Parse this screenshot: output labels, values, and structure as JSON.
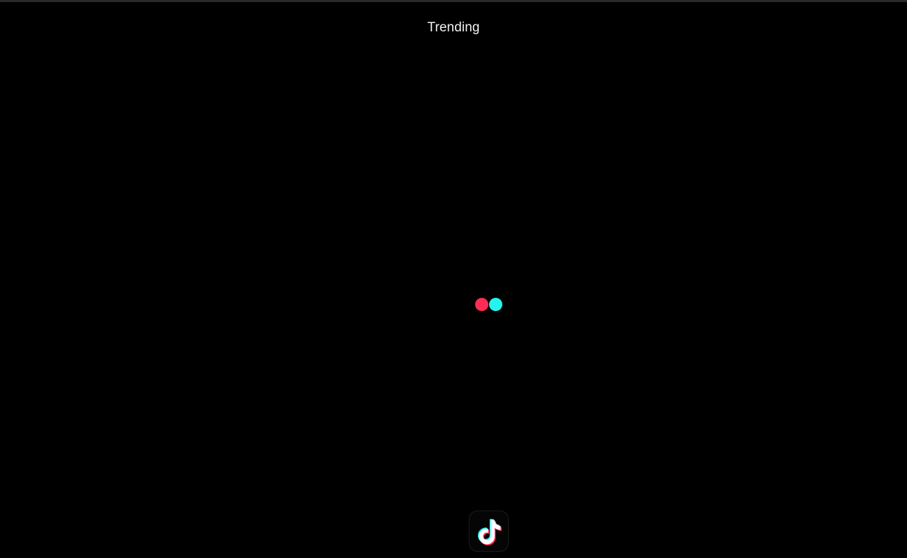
{
  "header": {
    "title": "Trending"
  },
  "loader": {
    "left_dot_color": "#fe2c55",
    "right_dot_color": "#25f4ee"
  },
  "bottom": {
    "app_icon": "tiktok-logo-icon"
  },
  "colors": {
    "background": "#000000",
    "title_text": "#f2f2f2",
    "brand_red": "#fe2c55",
    "brand_cyan": "#25f4ee"
  }
}
